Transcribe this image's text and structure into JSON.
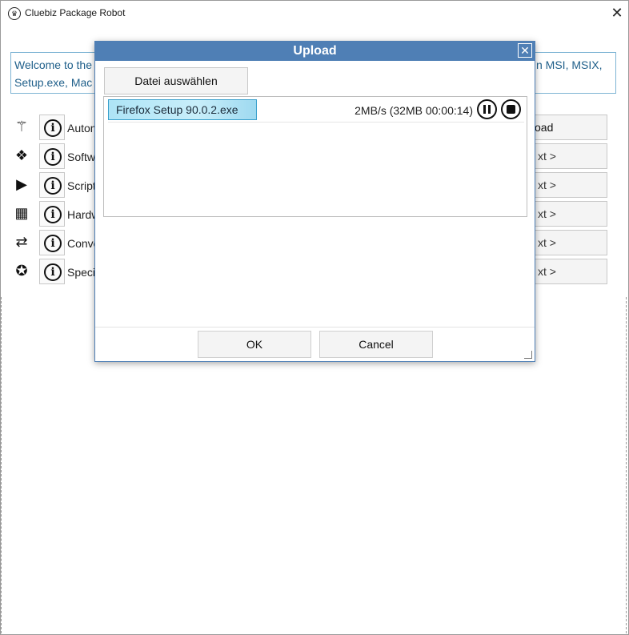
{
  "window": {
    "title": "Cluebiz Package Robot",
    "close_glyph": "✕",
    "app_icon": "robot-icon"
  },
  "welcome": {
    "line1_left": "Welcome to the",
    "line1_right": "n MSI, MSIX,",
    "line2_left": "Setup.exe, Mac"
  },
  "rows": [
    {
      "icon": "magic-wand-icon",
      "glyph": "⚚",
      "label": "Auton",
      "button": "oad"
    },
    {
      "icon": "boxes-icon",
      "glyph": "❖",
      "label": "Softw",
      "button": "xt >"
    },
    {
      "icon": "play-icon",
      "glyph": "▶",
      "label": "Script",
      "button": "xt >"
    },
    {
      "icon": "hardware-icon",
      "glyph": "▦",
      "label": "Hardw",
      "button": "xt >"
    },
    {
      "icon": "convert-icon",
      "glyph": "⇄",
      "label": "Conve",
      "button": "xt >"
    },
    {
      "icon": "star-icon",
      "glyph": "✪",
      "label": "Speci",
      "button": "xt >"
    }
  ],
  "info_glyph": "i",
  "dialog": {
    "title": "Upload",
    "close_glyph": "✕",
    "choose_button": "Datei auswählen",
    "upload": {
      "filename": "Firefox Setup 90.0.2.exe",
      "status": "2MB/s (32MB 00:00:14)",
      "pause_icon": "pause-icon",
      "stop_icon": "stop-icon"
    },
    "ok_button": "OK",
    "cancel_button": "Cancel"
  }
}
